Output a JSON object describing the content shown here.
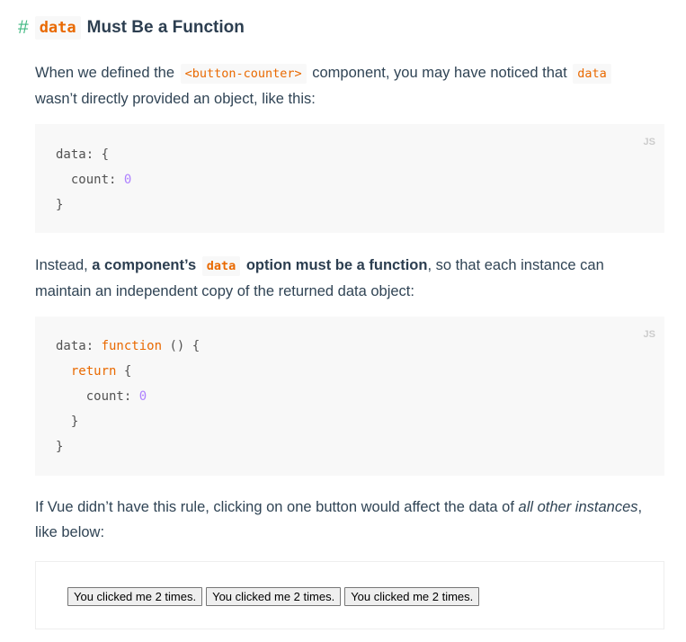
{
  "heading": {
    "hash": "#",
    "code": "data",
    "text": "Must Be a Function"
  },
  "para1": {
    "t1": "When we defined the ",
    "code1": "<button-counter>",
    "t2": " component, you may have noticed that ",
    "code2": "data",
    "t3": " wasn’t directly provided an object, like this:"
  },
  "code1": {
    "lang": "JS",
    "lines": {
      "l1a": "data: {",
      "l2a": "  count: ",
      "l2num": "0",
      "l3a": "}"
    }
  },
  "para2": {
    "t1": "Instead, ",
    "strong1": "a component’s ",
    "code": "data",
    "strong2": " option must be a function",
    "t2": ", so that each instance can maintain an independent copy of the returned data object:"
  },
  "code2": {
    "lang": "JS",
    "lines": {
      "l1a": "data: ",
      "l1kw": "function",
      "l1b": " () {",
      "l2a": "  ",
      "l2kw": "return",
      "l2b": " {",
      "l3a": "    count: ",
      "l3num": "0",
      "l4a": "  }",
      "l5a": "}"
    }
  },
  "para3": {
    "t1": "If Vue didn’t have this rule, clicking on one button would affect the data of ",
    "em": "all other instances",
    "t2": ", like below:"
  },
  "demo": {
    "buttons": [
      "You clicked me 2 times.",
      "You clicked me 2 times.",
      "You clicked me 2 times."
    ]
  },
  "colors": {
    "accent": "#42b983",
    "code": "#e96900",
    "number": "#ae81ff",
    "text": "#2c3e50",
    "code_bg": "#f8f8f8"
  }
}
